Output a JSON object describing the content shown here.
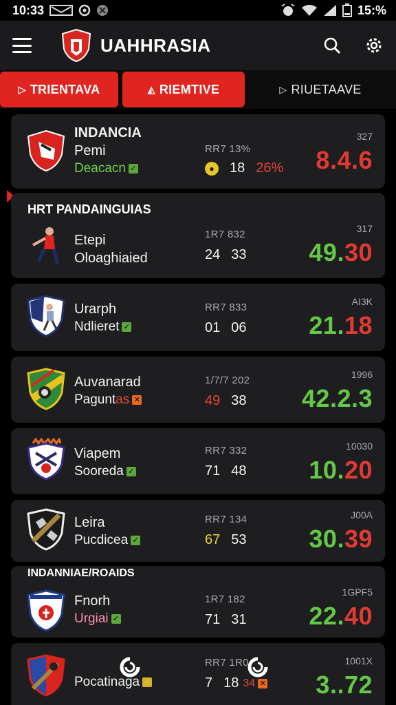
{
  "status_bar": {
    "time": "10:33",
    "battery": "15:%"
  },
  "app_bar": {
    "title": "UAHHRASIA"
  },
  "tabs": [
    {
      "label": "TRIENTAVA",
      "active": true
    },
    {
      "label": "RIEMTIVE",
      "active": true
    },
    {
      "label": "RIUETAAVE",
      "active": false
    }
  ],
  "section_labels": {
    "first": "HRT PANDAINGUIAS",
    "second": "INDANNIAE/ROAIDS"
  },
  "colors": {
    "accent": "#e0241f",
    "odds_green": "#64c847",
    "odds_red": "#e23a33",
    "card": "#1e1e20"
  },
  "matches": [
    {
      "name": "INDANCIA",
      "name_bold": true,
      "line2": "Pemi",
      "line3": "Deacacn",
      "stat_top": "RR7 13%",
      "stat_a": "18",
      "stat_b": "26%",
      "odds_label": "327",
      "odds_int": "8.",
      "odds_frac": "4.6",
      "emblem": "shield-red-icon"
    },
    {
      "name": "Etepi",
      "line3": "Oloaghiaied",
      "stat_top": "1R7 832",
      "stat_a": "24",
      "stat_b": "33",
      "odds_label": "317",
      "odds_int": "49.",
      "odds_frac": "30",
      "emblem": "player-icon"
    },
    {
      "name": "Urarph",
      "line3": "Ndlieret",
      "stat_top": "RR7 833",
      "stat_a": "01",
      "stat_b": "06",
      "odds_label": "AI3K",
      "odds_int": "21.",
      "odds_frac": "18",
      "emblem": "shield-blue-icon"
    },
    {
      "name": "Auvanarad",
      "line3": "Pagunt",
      "line3_tail": "as",
      "stat_top": "1/7/7 202",
      "stat_a": "49",
      "stat_b": "38",
      "odds_label": "1996",
      "odds_int": "42.",
      "odds_frac": "2.3",
      "emblem": "shield-green-icon"
    },
    {
      "name": "Viapem",
      "line3": "Sooreda",
      "stat_top": "RR7 332",
      "stat_a": "71",
      "stat_b": "48",
      "odds_label": "10030",
      "odds_int": "10.",
      "odds_frac": "20",
      "emblem": "shield-purple-icon"
    },
    {
      "name": "Leira",
      "line3": "Pucdicea",
      "stat_top": "RR7 134",
      "stat_a": "67",
      "stat_b": "53",
      "odds_label": "J00A",
      "odds_int": "30.",
      "odds_frac": "39",
      "emblem": "shield-black-icon"
    },
    {
      "name": "Fnorh",
      "line3": "Urgiai",
      "stat_top": "1R7 182",
      "stat_a": "71",
      "stat_b": "31",
      "odds_label": "1GPF5",
      "odds_int": "22.",
      "odds_frac": "40",
      "emblem": "shield-white-icon"
    },
    {
      "name": "",
      "line3": "Pocatinaga",
      "stat_top": "RR7 1R0",
      "stat_a": "7",
      "stat_b": "18",
      "stat_c": "34",
      "odds_label": "1001X",
      "odds_int": "3.",
      "odds_frac": ".72",
      "emblem": "shield-red-blue-icon"
    }
  ]
}
